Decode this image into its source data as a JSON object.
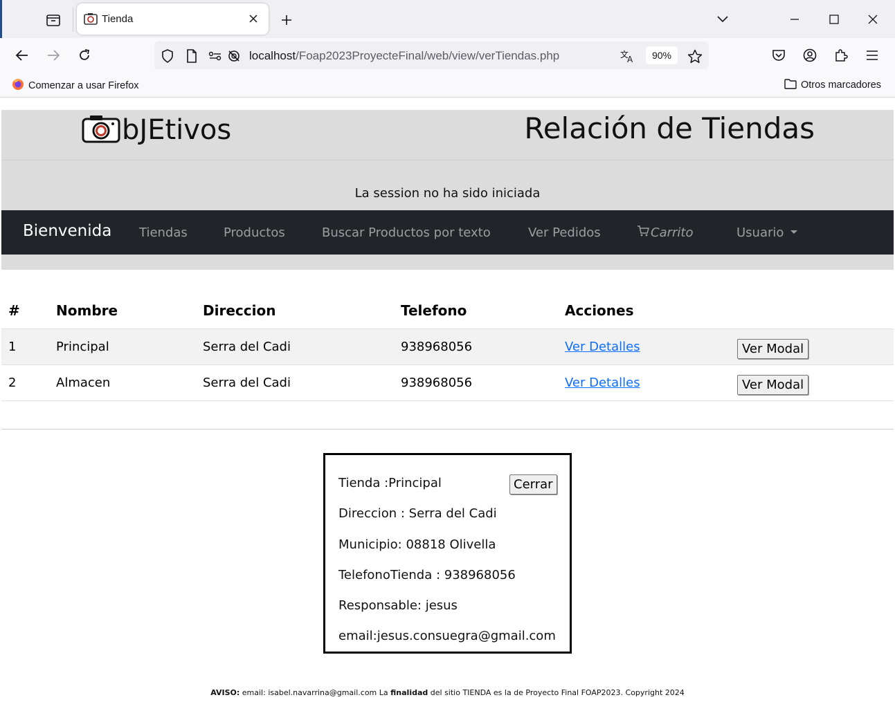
{
  "browser": {
    "tab_title": "Tienda",
    "url_host": "localhost",
    "url_path": "/Foap2023ProyecteFinal/web/view/verTiendas.php",
    "zoom": "90%",
    "bookmark_left": "Comenzar a usar Firefox",
    "bookmark_right": "Otros marcadores"
  },
  "header": {
    "logo_text": "bJEtivos",
    "title": "Relación de Tiendas",
    "session_text": "La session no ha sido iniciada"
  },
  "nav": {
    "brand": "Bienvenida",
    "links": [
      "Tiendas",
      "Productos",
      "Buscar Productos por texto",
      "Ver Pedidos",
      "Carrito",
      "Usuario"
    ]
  },
  "table": {
    "headers": [
      "#",
      "Nombre",
      "Direccion",
      "Telefono",
      "Acciones"
    ],
    "rows": [
      {
        "num": "1",
        "nombre": "Principal",
        "direccion": "Serra del Cadi",
        "telefono": "938968056",
        "link": "Ver Detalles",
        "button": "Ver Modal"
      },
      {
        "num": "2",
        "nombre": "Almacen",
        "direccion": "Serra del Cadi",
        "telefono": "938968056",
        "link": "Ver Detalles",
        "button": "Ver Modal"
      }
    ]
  },
  "modal": {
    "tienda": "Tienda :Principal",
    "direccion": "Direccion : Serra del Cadi",
    "municipio": "Municipio: 08818 Olivella",
    "telefono": "TelefonoTienda : 938968056",
    "responsable": "Responsable: jesus",
    "email": "email:jesus.consuegra@gmail.com",
    "close_label": "Cerrar"
  },
  "footer": {
    "aviso_label": "AVISO:",
    "part1": " email: isabel.navarrina@gmail.com La ",
    "finalidad": "finalidad",
    "part2": " del sitio TIENDA es la de Proyecto Final FOAP2023. Copyright 2024"
  }
}
